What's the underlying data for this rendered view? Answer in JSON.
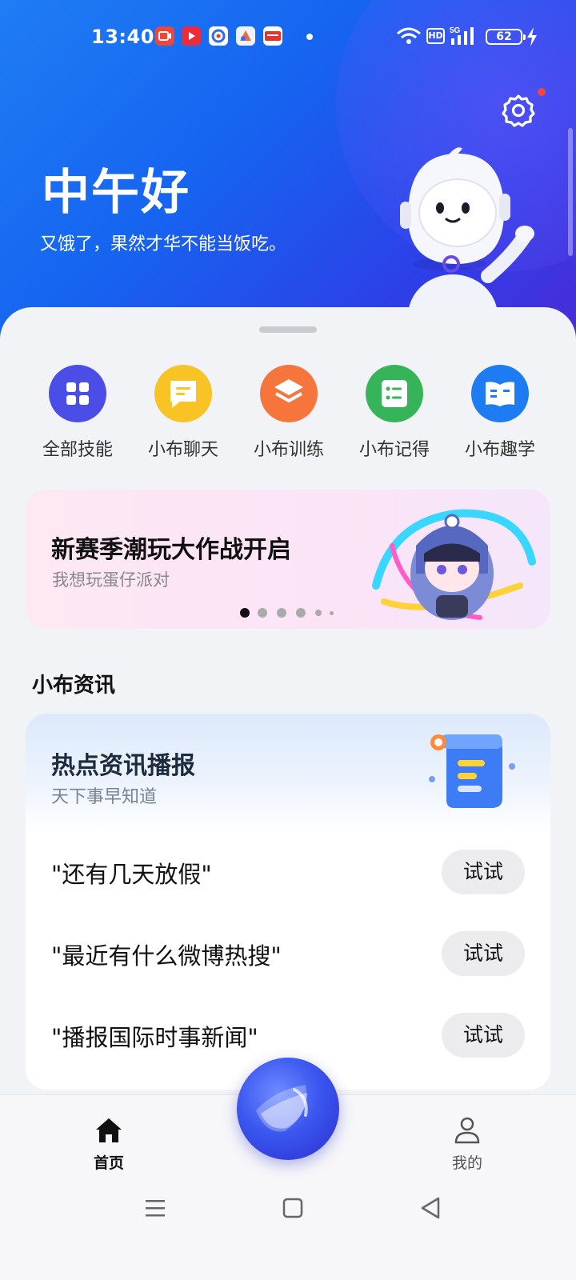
{
  "status_bar": {
    "time": "13:40",
    "app_icons": [
      "video-app-icon",
      "youtube-like-icon",
      "baidu-app-icon",
      "image-app-icon",
      "toutiao-app-icon"
    ],
    "hd_label": "HD",
    "network": "5G",
    "battery": "62"
  },
  "header": {
    "greeting": "中午好",
    "subtitle": "又饿了，果然才华不能当饭吃。"
  },
  "skills": [
    {
      "label": "全部技能",
      "color": "#4b4ee6",
      "icon": "grid-icon"
    },
    {
      "label": "小布聊天",
      "color": "#f7c325",
      "icon": "chat-icon"
    },
    {
      "label": "小布训练",
      "color": "#f6753c",
      "icon": "layers-icon"
    },
    {
      "label": "小布记得",
      "color": "#35b45a",
      "icon": "list-icon"
    },
    {
      "label": "小布趣学",
      "color": "#1d7cf2",
      "icon": "book-icon"
    }
  ],
  "banner": {
    "title": "新赛季潮玩大作战开启",
    "subtitle": "我想玩蛋仔派对",
    "page_count": 6,
    "active_page": 1
  },
  "news_section": {
    "title": "小布资讯",
    "card_title": "热点资讯播报",
    "card_subtitle": "天下事早知道",
    "items": [
      {
        "query": "\"还有几天放假\"",
        "button": "试试"
      },
      {
        "query": "\"最近有什么微博热搜\"",
        "button": "试试"
      },
      {
        "query": "\"播报国际时事新闻\"",
        "button": "试试"
      }
    ]
  },
  "bottom_nav": {
    "home": "首页",
    "mine": "我的"
  }
}
